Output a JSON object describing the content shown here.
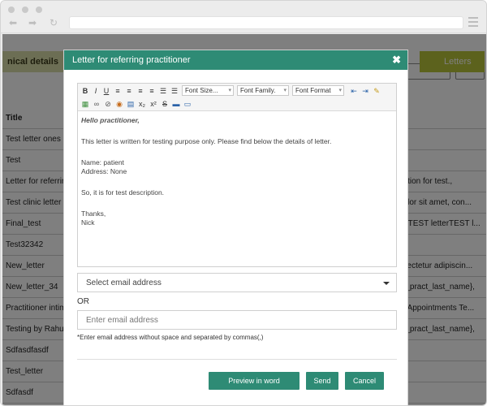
{
  "background": {
    "tab_left": "nical details",
    "tab_right": "Letters",
    "rows": [
      {
        "title": "Title",
        "detail": ""
      },
      {
        "title": "Test letter ones",
        "detail": ""
      },
      {
        "title": "Test",
        "detail": ""
      },
      {
        "title": "Letter for referring",
        "detail": "erition for test.,"
      },
      {
        "title": "Test clinic letter",
        "detail": "dolor sit amet, con..."
      },
      {
        "title": "Final_test",
        "detail": "terTEST letterTEST l..."
      },
      {
        "title": "Test32342",
        "detail": ""
      },
      {
        "title": "New_letter",
        "detail": "nsectetur adipiscin..."
      },
      {
        "title": "New_letter_34",
        "detail": "ef_pract_last_name},"
      },
      {
        "title": "Practitioner intimat",
        "detail": "to Appointments Te..."
      },
      {
        "title": "Testing by Rahul",
        "detail": "ef_pract_last_name},"
      },
      {
        "title": "Sdfasdfasdf",
        "detail": ""
      },
      {
        "title": "Test_letter",
        "detail": ""
      },
      {
        "title": "Sdfasdf",
        "detail": ""
      }
    ]
  },
  "modal": {
    "title": "Letter for referring practitioner",
    "close": "✖",
    "toolbar": {
      "font_size": "Font Size...",
      "font_family": "Font Family.",
      "font_format": "Font Format"
    },
    "letter_body": {
      "line1": "Hello practitioner,",
      "line2": "This letter is written for testing purpose only. Please find below the details of letter.",
      "line3": "Name: patient",
      "line4": "Address: None",
      "line5": "So, it is for test description.",
      "line6": "Thanks,",
      "line7": "Nick"
    },
    "select_placeholder": "Select email address",
    "or_label": "OR",
    "email_placeholder": "Enter email address",
    "hint": "*Enter email address without space and separated by commas(,)",
    "buttons": {
      "preview": "Preview in word",
      "send": "Send",
      "cancel": "Cancel"
    }
  },
  "colors": {
    "primary": "#2e8b75",
    "accent": "#b9c43a"
  }
}
